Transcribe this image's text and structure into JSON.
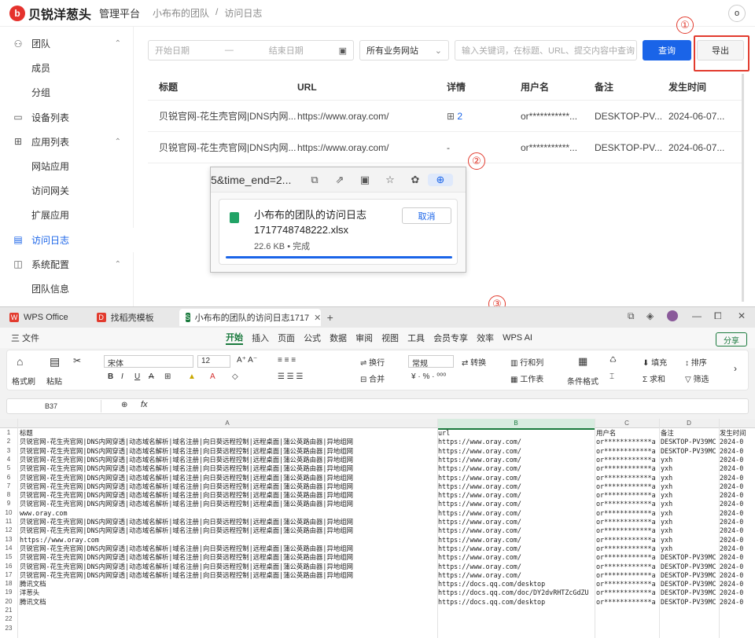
{
  "header": {
    "brand": "贝锐洋葱头",
    "logo_letter": "b",
    "platform": "管理平台",
    "crumbs": [
      "小布布的团队",
      "/",
      "访问日志"
    ],
    "avatar": "o"
  },
  "sidebar": {
    "items": [
      {
        "label": "团队",
        "icon": "user-group-icon",
        "glyph": "⚇",
        "chev": "⌃"
      },
      {
        "label": "成员",
        "sub": true
      },
      {
        "label": "分组",
        "sub": true
      },
      {
        "label": "设备列表",
        "icon": "device-icon",
        "glyph": "▭"
      },
      {
        "label": "应用列表",
        "icon": "apps-icon",
        "glyph": "⊞",
        "chev": "⌃"
      },
      {
        "label": "网站应用",
        "sub": true
      },
      {
        "label": "访问网关",
        "sub": true
      },
      {
        "label": "扩展应用",
        "sub": true
      },
      {
        "label": "访问日志",
        "icon": "log-icon",
        "glyph": "▤",
        "active": true
      },
      {
        "label": "系统配置",
        "icon": "settings-icon",
        "glyph": "◫",
        "chev": "⌃"
      },
      {
        "label": "团队信息",
        "sub": true
      }
    ]
  },
  "filters": {
    "start_date": "开始日期",
    "sep": "—",
    "end_date": "结束日期",
    "site": "所有业务网站",
    "keyword_placeholder": "输入关键词，在标题、URL、提交内容中查询",
    "query": "查询",
    "export": "导出"
  },
  "table": {
    "headers": [
      "标题",
      "URL",
      "详情",
      "用户名",
      "备注",
      "发生时间"
    ],
    "rows": [
      {
        "title": "贝锐官网-花生壳官网|DNS内网...",
        "url": "https://www.oray.com/",
        "detail": "2",
        "user": "or***********...",
        "note": "DESKTOP-PV...",
        "time": "2024-06-07..."
      },
      {
        "title": "贝锐官网-花生壳官网|DNS内网...",
        "url": "https://www.oray.com/",
        "detail": "-",
        "user": "or***********...",
        "note": "DESKTOP-PV...",
        "time": "2024-06-07..."
      }
    ]
  },
  "annotations": {
    "one": "①",
    "two": "②",
    "three": "③",
    "color": "#e23b2e"
  },
  "download": {
    "url": "5&time_end=2...",
    "filename_line1": "小布布的团队的访问日志",
    "filename_line2": "1717748748222.xlsx",
    "meta": "22.6 KB • 完成",
    "cancel": "取消",
    "progress": 1.0
  },
  "wps": {
    "tabs": [
      "WPS Office",
      "找稻壳模板",
      "小布布的团队的访问日志1717"
    ],
    "tab_icons": [
      "W",
      "D",
      "S"
    ],
    "new_tab": "+",
    "menu": [
      "三 文件",
      "开始",
      "插入",
      "页面",
      "公式",
      "数据",
      "审阅",
      "视图",
      "工具",
      "会员专享",
      "效率",
      "WPS AI"
    ],
    "share": "分享",
    "font": "宋体",
    "font_size": "12",
    "number_format": "常规",
    "ribbon": {
      "brush": "格式刷",
      "paste": "粘贴",
      "wrap": "换行",
      "merge": "合并",
      "convert": "转换",
      "rowcol": "行和列",
      "sheet": "工作表",
      "cond": "条件格式",
      "fill": "填充",
      "sum": "求和",
      "sort": "排序",
      "filter": "筛选"
    },
    "cell_ref": "B37",
    "fx": "fx",
    "columns": [
      "A",
      "B",
      "C",
      "D"
    ],
    "rows": [
      [
        "标题",
        "url",
        "用户名",
        "备注",
        "发生时间"
      ],
      [
        "贝锐官网-花生壳官网|DNS内网穿透|动态域名解析|域名注册|向日葵远程控制|远程桌面|蒲公英路由器|异地组网",
        "https://www.oray.com/",
        "or************a",
        "DESKTOP-PV39MC",
        "2024-0"
      ],
      [
        "贝锐官网-花生壳官网|DNS内网穿透|动态域名解析|域名注册|向日葵远程控制|远程桌面|蒲公英路由器|异地组网",
        "https://www.oray.com/",
        "or************a",
        "DESKTOP-PV39MC",
        "2024-0"
      ],
      [
        "贝锐官网-花生壳官网|DNS内网穿透|动态域名解析|域名注册|向日葵远程控制|远程桌面|蒲公英路由器|异地组网",
        "https://www.oray.com/",
        "or************a",
        "yxh",
        "2024-0"
      ],
      [
        "贝锐官网-花生壳官网|DNS内网穿透|动态域名解析|域名注册|向日葵远程控制|远程桌面|蒲公英路由器|异地组网",
        "https://www.oray.com/",
        "or************a",
        "yxh",
        "2024-0"
      ],
      [
        "贝锐官网-花生壳官网|DNS内网穿透|动态域名解析|域名注册|向日葵远程控制|远程桌面|蒲公英路由器|异地组网",
        "https://www.oray.com/",
        "or************a",
        "yxh",
        "2024-0"
      ],
      [
        "贝锐官网-花生壳官网|DNS内网穿透|动态域名解析|域名注册|向日葵远程控制|远程桌面|蒲公英路由器|异地组网",
        "https://www.oray.com/",
        "or************a",
        "yxh",
        "2024-0"
      ],
      [
        "贝锐官网-花生壳官网|DNS内网穿透|动态域名解析|域名注册|向日葵远程控制|远程桌面|蒲公英路由器|异地组网",
        "https://www.oray.com/",
        "or************a",
        "yxh",
        "2024-0"
      ],
      [
        "贝锐官网-花生壳官网|DNS内网穿透|动态域名解析|域名注册|向日葵远程控制|远程桌面|蒲公英路由器|异地组网",
        "https://www.oray.com/",
        "or************a",
        "yxh",
        "2024-0"
      ],
      [
        "www.oray.com",
        "https://www.oray.com/",
        "or************a",
        "yxh",
        "2024-0"
      ],
      [
        "贝锐官网-花生壳官网|DNS内网穿透|动态域名解析|域名注册|向日葵远程控制|远程桌面|蒲公英路由器|异地组网",
        "https://www.oray.com/",
        "or************a",
        "yxh",
        "2024-0"
      ],
      [
        "贝锐官网-花生壳官网|DNS内网穿透|动态域名解析|域名注册|向日葵远程控制|远程桌面|蒲公英路由器|异地组网",
        "https://www.oray.com/",
        "or************a",
        "yxh",
        "2024-0"
      ],
      [
        "https://www.oray.com",
        "https://www.oray.com/",
        "or************a",
        "yxh",
        "2024-0"
      ],
      [
        "贝锐官网-花生壳官网|DNS内网穿透|动态域名解析|域名注册|向日葵远程控制|远程桌面|蒲公英路由器|异地组网",
        "https://www.oray.com/",
        "or************a",
        "yxh",
        "2024-0"
      ],
      [
        "贝锐官网-花生壳官网|DNS内网穿透|动态域名解析|域名注册|向日葵远程控制|远程桌面|蒲公英路由器|异地组网",
        "https://www.oray.com/",
        "or************a",
        "DESKTOP-PV39MC",
        "2024-0"
      ],
      [
        "贝锐官网-花生壳官网|DNS内网穿透|动态域名解析|域名注册|向日葵远程控制|远程桌面|蒲公英路由器|异地组网",
        "https://www.oray.com/",
        "or************a",
        "DESKTOP-PV39MC",
        "2024-0"
      ],
      [
        "贝锐官网-花生壳官网|DNS内网穿透|动态域名解析|域名注册|向日葵远程控制|远程桌面|蒲公英路由器|异地组网",
        "https://www.oray.com/",
        "or************a",
        "DESKTOP-PV39MC",
        "2024-0"
      ],
      [
        "腾讯文档",
        "https://docs.qq.com/desktop",
        "or************a",
        "DESKTOP-PV39MC",
        "2024-0"
      ],
      [
        "洋葱头",
        "https://docs.qq.com/doc/DY2dvRHTZcGdZU",
        "or************a",
        "DESKTOP-PV39MC",
        "2024-0"
      ],
      [
        "腾讯文档",
        "https://docs.qq.com/desktop",
        "or************a",
        "DESKTOP-PV39MC",
        "2024-0"
      ]
    ],
    "row_numbers": [
      "1",
      "2",
      "3",
      "4",
      "5",
      "6",
      "7",
      "8",
      "9",
      "10",
      "11",
      "12",
      "13",
      "14",
      "15",
      "16",
      "17",
      "18",
      "19",
      "20",
      "21",
      "22",
      "23"
    ]
  }
}
